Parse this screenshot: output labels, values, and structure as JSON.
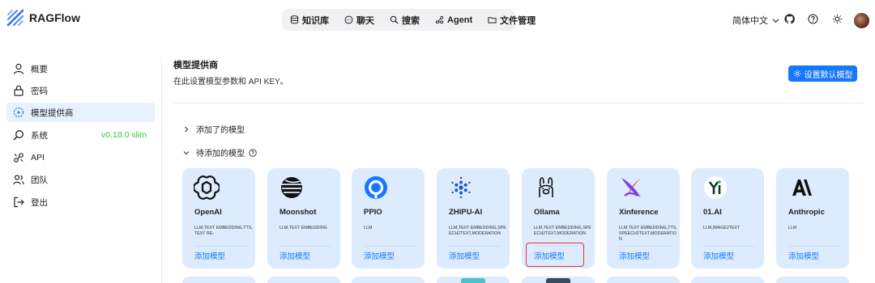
{
  "header": {
    "brand": "RAGFlow",
    "nav": [
      {
        "label": "知识库",
        "icon": "database-icon"
      },
      {
        "label": "聊天",
        "icon": "chat-icon"
      },
      {
        "label": "搜索",
        "icon": "search-icon"
      },
      {
        "label": "Agent",
        "icon": "agent-icon"
      },
      {
        "label": "文件管理",
        "icon": "folder-icon"
      }
    ],
    "language": "简体中文",
    "icons": [
      "github-icon",
      "help-icon",
      "theme-sun-icon",
      "avatar"
    ]
  },
  "sidebar": {
    "items": [
      {
        "label": "概要",
        "icon": "user-icon"
      },
      {
        "label": "密码",
        "icon": "lock-icon"
      },
      {
        "label": "模型提供商",
        "icon": "model-icon",
        "active": true
      },
      {
        "label": "系统",
        "icon": "system-search-icon"
      },
      {
        "label": "API",
        "icon": "api-icon"
      },
      {
        "label": "团队",
        "icon": "team-icon"
      },
      {
        "label": "登出",
        "icon": "logout-icon"
      }
    ],
    "version": "v0.18.0 slim"
  },
  "main": {
    "title": "模型提供商",
    "subtitle": "在此设置模型参数和 API KEY。",
    "default_model_button": "设置默认模型",
    "added_section": "添加了的模型",
    "pending_section": "待添加的模型"
  },
  "providers": [
    {
      "name": "OpenAI",
      "tags": "LLM,TEXT EMBEDDING,TTS,TEXT RE-",
      "add": "添加模型"
    },
    {
      "name": "Moonshot",
      "tags": "LLM,TEXT EMBEDDING",
      "add": "添加模型"
    },
    {
      "name": "PPIO",
      "tags": "LLM",
      "add": "添加模型"
    },
    {
      "name": "ZHIPU-AI",
      "tags": "LLM,TEXT EMBEDDING,SPEECH2TEXT,MODERATION",
      "add": "添加模型"
    },
    {
      "name": "Ollama",
      "tags": "LLM,TEXT EMBEDDING,SPEECH2TEXT,MODERATION",
      "add": "添加模型"
    },
    {
      "name": "Xinference",
      "tags": "LLM,TEXT EMBEDDING,TTS,SPEECH2TEXT,MODERATION",
      "add": "添加模型"
    },
    {
      "name": "01.AI",
      "tags": "LLM,IMAGE2TEXT",
      "add": "添加模型"
    },
    {
      "name": "Anthropic",
      "tags": "LLM",
      "add": "添加模型"
    }
  ],
  "colors": {
    "accent": "#1677ff",
    "active_bg": "#e7f1ff",
    "card_bg": "#dcebfd",
    "version": "#34c934",
    "highlight": "#e0372e"
  }
}
